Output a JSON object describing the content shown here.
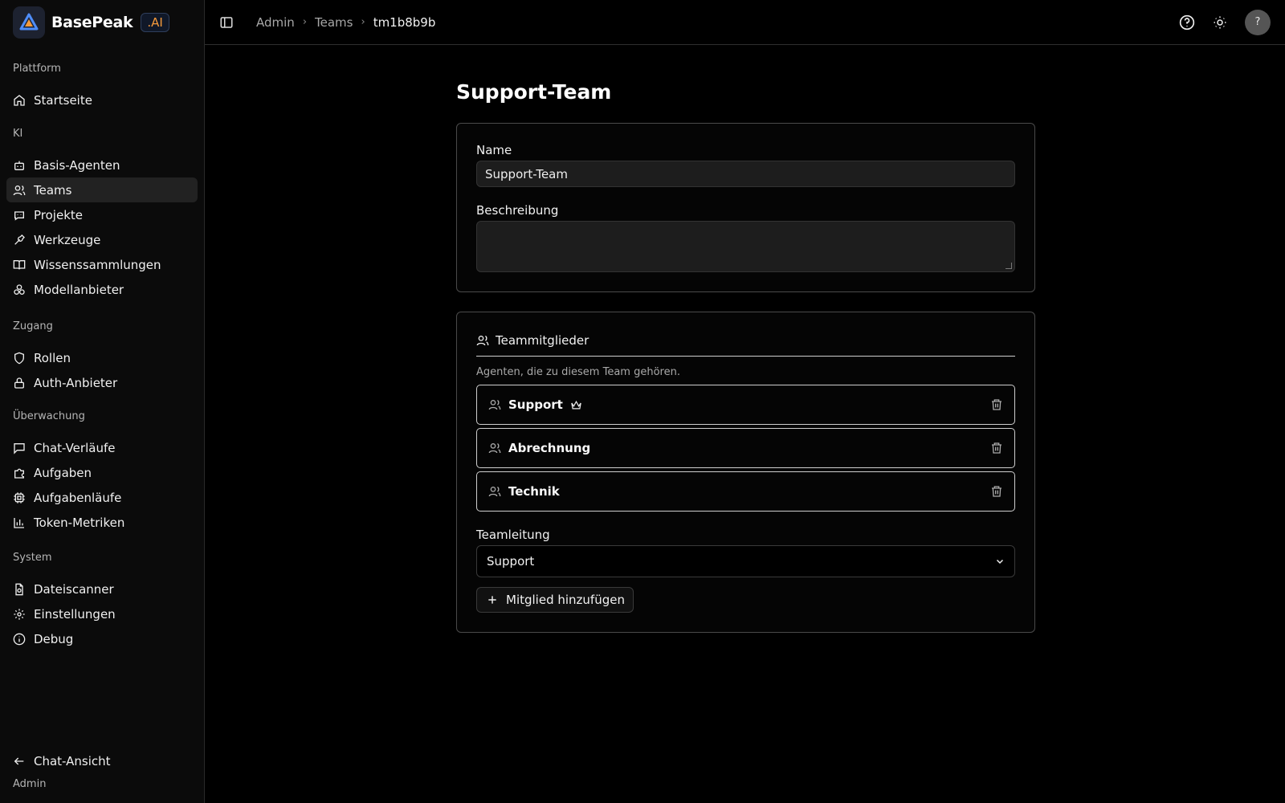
{
  "brand": {
    "name": "BasePeak",
    "suffix": ".AI"
  },
  "sidebar": {
    "groups": [
      {
        "label": "Plattform",
        "items": [
          {
            "label": "Startseite",
            "icon": "home-icon"
          }
        ]
      },
      {
        "label": "KI",
        "items": [
          {
            "label": "Basis-Agenten",
            "icon": "bot-icon"
          },
          {
            "label": "Teams",
            "icon": "users-icon",
            "active": true
          },
          {
            "label": "Projekte",
            "icon": "bot-message-icon"
          },
          {
            "label": "Werkzeuge",
            "icon": "wrench-icon"
          },
          {
            "label": "Wissenssammlungen",
            "icon": "book-icon"
          },
          {
            "label": "Modellanbieter",
            "icon": "boxes-icon"
          }
        ]
      },
      {
        "label": "Zugang",
        "items": [
          {
            "label": "Rollen",
            "icon": "shield-icon"
          },
          {
            "label": "Auth-Anbieter",
            "icon": "lock-icon"
          }
        ]
      },
      {
        "label": "Überwachung",
        "items": [
          {
            "label": "Chat-Verläufe",
            "icon": "message-square-icon"
          },
          {
            "label": "Aufgaben",
            "icon": "puzzle-icon"
          },
          {
            "label": "Aufgabenläufe",
            "icon": "cpu-icon"
          },
          {
            "label": "Token-Metriken",
            "icon": "bar-chart-icon"
          }
        ]
      },
      {
        "label": "System",
        "items": [
          {
            "label": "Dateiscanner",
            "icon": "file-scan-icon"
          },
          {
            "label": "Einstellungen",
            "icon": "gear-icon"
          },
          {
            "label": "Debug",
            "icon": "info-icon"
          }
        ]
      }
    ],
    "footer": {
      "back_label": "Chat-Ansicht",
      "user_label": "Admin"
    }
  },
  "topbar": {
    "breadcrumbs": [
      "Admin",
      "Teams",
      "tm1b8b9b"
    ],
    "avatar_text": "?"
  },
  "page": {
    "title": "Support-Team",
    "name_label": "Name",
    "name_value": "Support-Team",
    "description_label": "Beschreibung",
    "description_value": ""
  },
  "members": {
    "heading": "Teammitglieder",
    "subtitle": "Agenten, die zu diesem Team gehören.",
    "list": [
      {
        "name": "Support",
        "leader": true
      },
      {
        "name": "Abrechnung",
        "leader": false
      },
      {
        "name": "Technik",
        "leader": false
      }
    ],
    "lead_label": "Teamleitung",
    "lead_value": "Support",
    "add_label": "Mitglied hinzufügen"
  },
  "colors": {
    "background": "#000000",
    "sidebar": "#0b0b0b",
    "accent": "#f59a3b",
    "border": "#cfcfcf"
  }
}
